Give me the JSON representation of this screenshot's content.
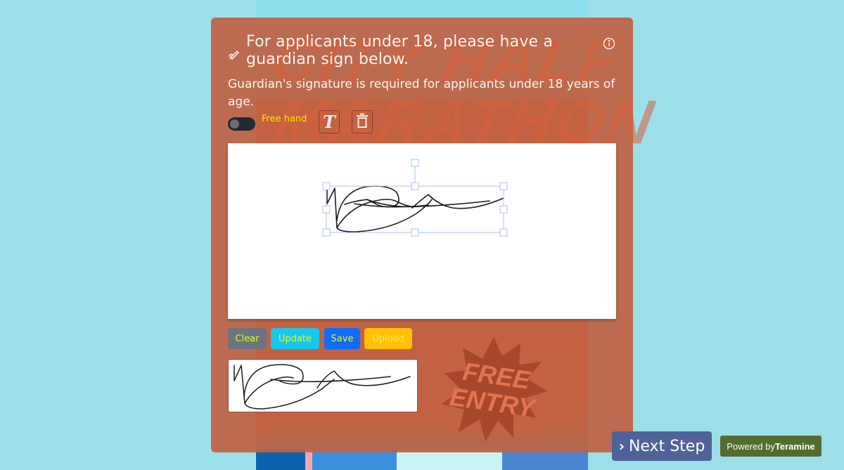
{
  "background": {
    "poster_title_line1": "CITY HALF",
    "poster_title_line2": "MARATHON",
    "poster_badge_line1": "FREE",
    "poster_badge_line2": "ENTRY"
  },
  "card": {
    "title": "For applicants under 18, please have a guardian sign below.",
    "description": "Guardian's signature is required for applicants under 18 years of age.",
    "icons": {
      "title_icon": "signature-pen-icon",
      "info_icon": "info-icon"
    }
  },
  "toolbar": {
    "freehand_label": "Free hand",
    "freehand_enabled": false,
    "text_tool_glyph": "T",
    "text_tool_icon": "text-icon",
    "delete_tool_icon": "trash-icon"
  },
  "buttons": {
    "clear": "Clear",
    "update": "Update",
    "save": "Save",
    "upload": "Upload"
  },
  "footer": {
    "next_step_chevron": "›",
    "next_step_label": "Next Step",
    "powered_by_prefix": "Powered by",
    "powered_by_brand": "Teramine"
  },
  "colors": {
    "card_bg": "#c06244",
    "page_bg": "#9ddfe8",
    "freehand_label": "#ffe500",
    "btn_clear": "#6c757d",
    "btn_update": "#17c8ec",
    "btn_save": "#0d6efd",
    "btn_upload": "#ffc107",
    "next_step": "#4f6399",
    "powered_bg": "#556b2f",
    "selection_handles": "#a9c4ee"
  }
}
